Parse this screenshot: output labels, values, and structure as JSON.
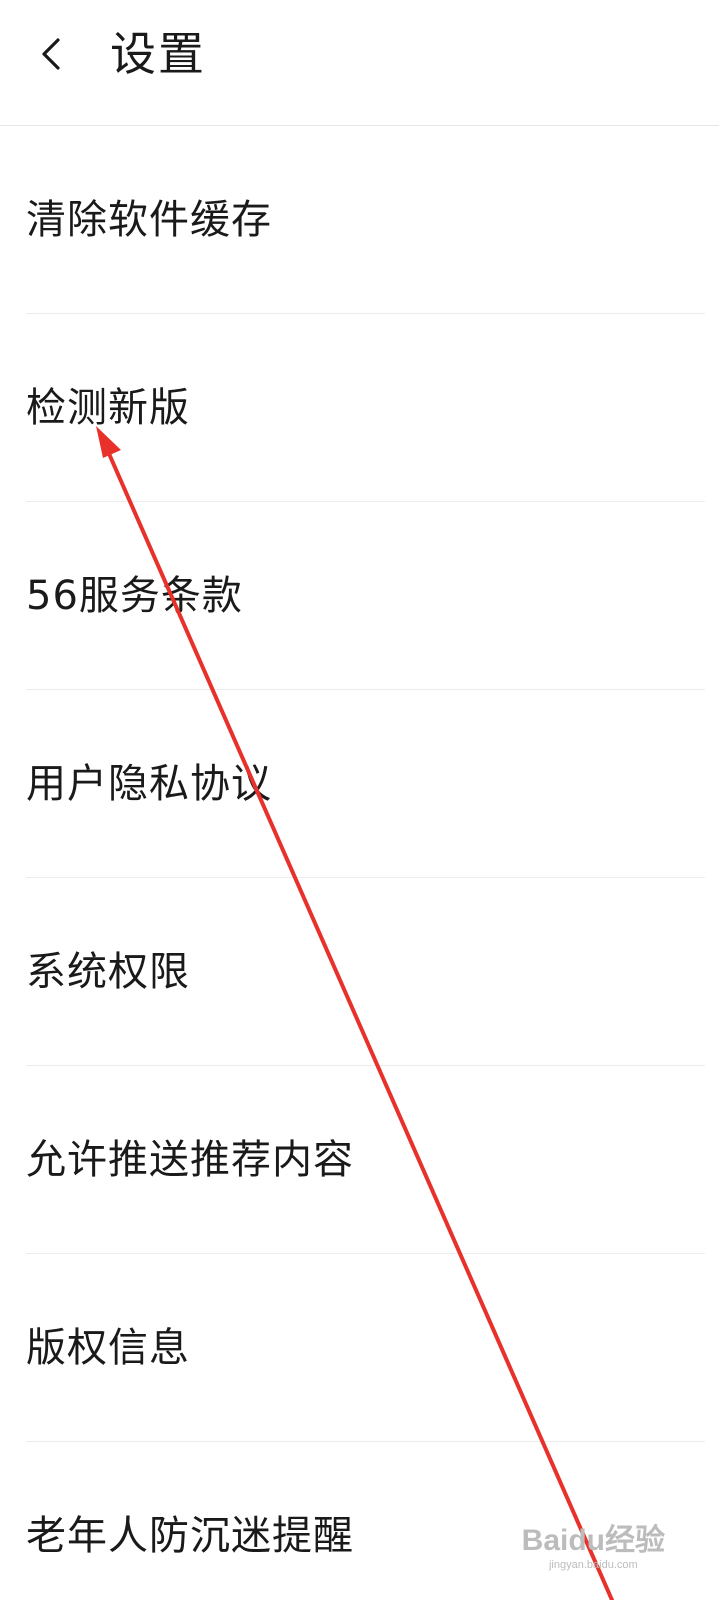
{
  "header": {
    "title": "设置",
    "back_icon": "chevron-left-icon"
  },
  "settings_items": [
    {
      "label": "清除软件缓存"
    },
    {
      "label": "检测新版"
    },
    {
      "label": "56服务条款"
    },
    {
      "label": "用户隐私协议"
    },
    {
      "label": "系统权限"
    },
    {
      "label": "允许推送推荐内容"
    },
    {
      "label": "版权信息"
    },
    {
      "label": "老年人防沉迷提醒"
    }
  ],
  "annotation": {
    "color": "#e8312a",
    "icon": "red-arrow-pointing-to-check-update"
  },
  "watermark": {
    "text": "Baidu经验",
    "sub": "jingyan.baidu.com"
  }
}
